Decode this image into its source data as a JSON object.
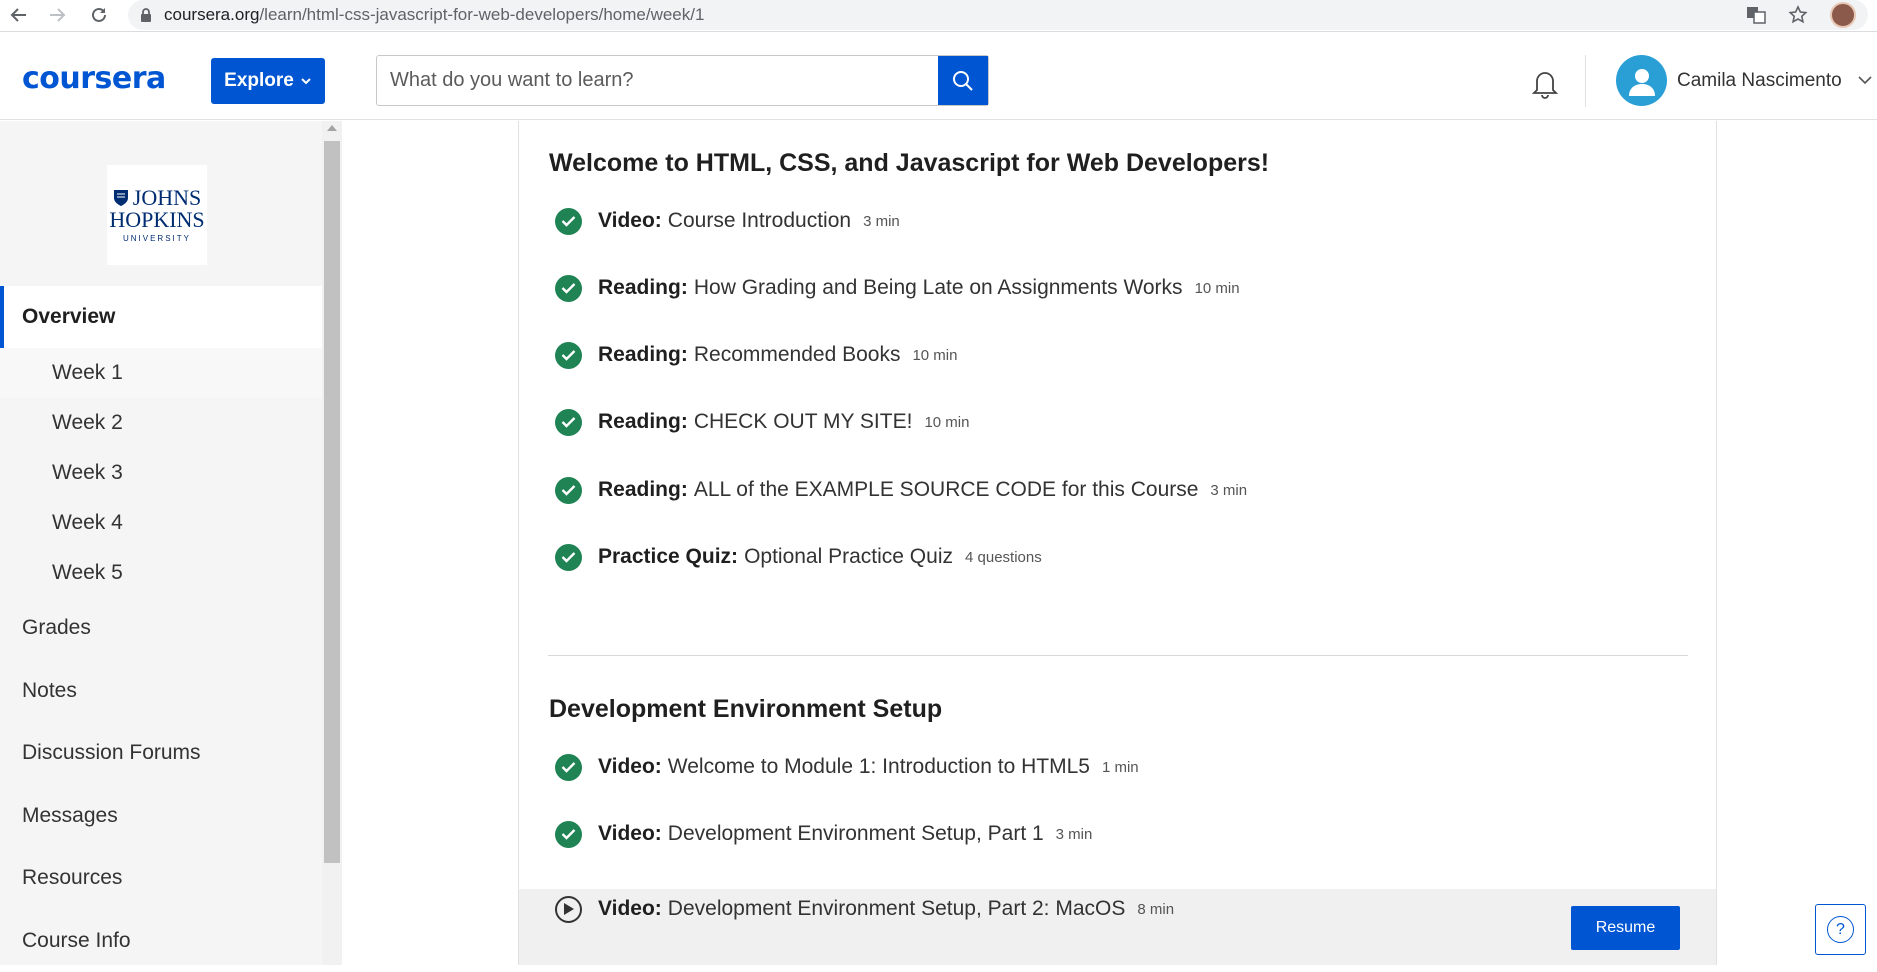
{
  "browser": {
    "url_host": "coursera.org",
    "url_path": "/learn/html-css-javascript-for-web-developers/home/week/1"
  },
  "header": {
    "logo": "coursera",
    "explore_label": "Explore",
    "search_placeholder": "What do you want to learn?",
    "user_name": "Camila Nascimento",
    "accent_color": "#0056d2"
  },
  "sidebar": {
    "university_logo": {
      "line1": "JOHNS",
      "line2": "HOPKINS",
      "line3": "UNIVERSITY"
    },
    "overview": "Overview",
    "weeks": [
      "Week 1",
      "Week 2",
      "Week 3",
      "Week 4",
      "Week 5"
    ],
    "active_week": "Week 1",
    "links": [
      "Grades",
      "Notes",
      "Discussion Forums",
      "Messages",
      "Resources",
      "Course Info"
    ]
  },
  "main": {
    "sections": [
      {
        "title": "Welcome to HTML, CSS, and Javascript for Web Developers!",
        "items": [
          {
            "type": "Video:",
            "name": "Course Introduction",
            "duration": "3 min",
            "status": "done"
          },
          {
            "type": "Reading:",
            "name": "How Grading and Being Late on Assignments Works",
            "duration": "10 min",
            "status": "done"
          },
          {
            "type": "Reading:",
            "name": "Recommended Books",
            "duration": "10 min",
            "status": "done"
          },
          {
            "type": "Reading:",
            "name": "CHECK OUT MY SITE!",
            "duration": "10 min",
            "status": "done"
          },
          {
            "type": "Reading:",
            "name": "ALL of the EXAMPLE SOURCE CODE for this Course",
            "duration": "3 min",
            "status": "done"
          },
          {
            "type": "Practice Quiz:",
            "name": "Optional Practice Quiz",
            "duration": "4 questions",
            "status": "done"
          }
        ]
      },
      {
        "title": "Development Environment Setup",
        "items": [
          {
            "type": "Video:",
            "name": "Welcome to Module 1: Introduction to HTML5",
            "duration": "1 min",
            "status": "done"
          },
          {
            "type": "Video:",
            "name": "Development Environment Setup, Part 1",
            "duration": "3 min",
            "status": "done"
          },
          {
            "type": "Video:",
            "name": "Development Environment Setup, Part 2: MacOS",
            "duration": "8 min",
            "status": "current"
          }
        ]
      }
    ],
    "resume_label": "Resume",
    "done_color": "#1f8354"
  },
  "help": {
    "label": "?"
  }
}
